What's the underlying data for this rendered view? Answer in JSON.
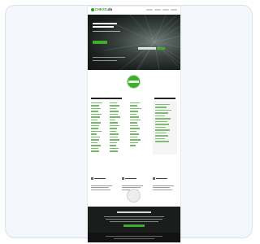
{
  "window": {
    "frame_background": "#f3f6fb",
    "page_background": "#ffffff"
  },
  "site": {
    "logo_text": "CHESS",
    "logo_suffix": ".do",
    "brand_color": "#2f9a2a"
  },
  "icons": {
    "logo": "logo-icon",
    "badge": "badge-icon",
    "seal": "seal-icon",
    "feature": "feature-icon"
  },
  "colors": {
    "accent_green": "#3fae2a",
    "link_green": "#4aa23a",
    "footer_dark": "#1b1d1c",
    "hero_dark": "#1a1f1d"
  }
}
